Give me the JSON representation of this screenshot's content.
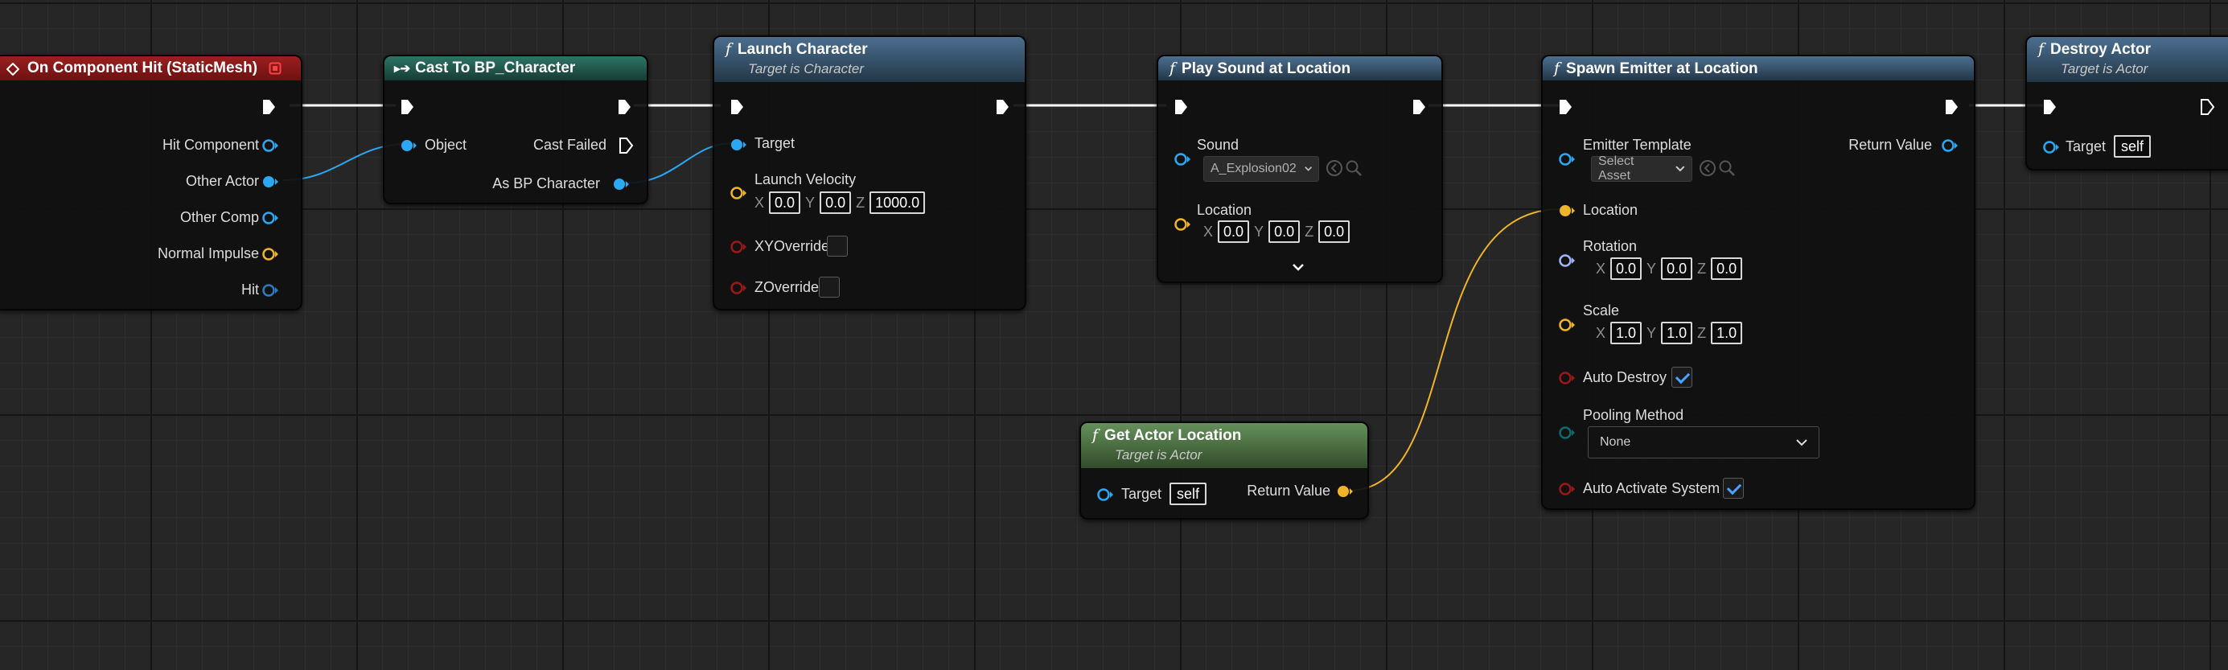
{
  "nodes": {
    "on_hit": {
      "title": "On Component Hit (StaticMesh)",
      "pins": [
        "Hit Component",
        "Other Actor",
        "Other Comp",
        "Normal Impulse",
        "Hit"
      ]
    },
    "cast": {
      "title": "Cast To BP_Character",
      "object": "Object",
      "cast_failed": "Cast Failed",
      "as_bp": "As BP Character"
    },
    "launch": {
      "title": "Launch Character",
      "subtitle": "Target is Character",
      "target": "Target",
      "launch_velocity": "Launch Velocity",
      "vx": "0.0",
      "vy": "0.0",
      "vz": "1000.0",
      "xy_override": "XYOverride",
      "z_override": "ZOverride"
    },
    "play_sound": {
      "title": "Play Sound at Location",
      "sound": "Sound",
      "sound_asset": "A_Explosion02",
      "location": "Location",
      "lx": "0.0",
      "ly": "0.0",
      "lz": "0.0"
    },
    "spawn": {
      "title": "Spawn Emitter at Location",
      "emitter_template": "Emitter Template",
      "select_asset": "Select Asset",
      "return_value": "Return Value",
      "location": "Location",
      "rotation": "Rotation",
      "rx": "0.0",
      "ry": "0.0",
      "rz": "0.0",
      "scale": "Scale",
      "sx": "1.0",
      "sy": "1.0",
      "sz": "1.0",
      "auto_destroy": "Auto Destroy",
      "pooling_method": "Pooling Method",
      "pooling_value": "None",
      "auto_activate": "Auto Activate System"
    },
    "destroy": {
      "title": "Destroy Actor",
      "subtitle": "Target is Actor",
      "target": "Target",
      "target_value": "self"
    },
    "get_loc": {
      "title": "Get Actor Location",
      "subtitle": "Target is Actor",
      "target": "Target",
      "target_value": "self",
      "return_value": "Return Value"
    }
  },
  "axis_letters": {
    "x": "X",
    "y": "Y",
    "z": "Z"
  },
  "colors": {
    "object_pin": "#2aa8f5",
    "struct_pin": "#f0b428",
    "bool_pin": "#8c1010",
    "rotator_pin": "#a0b4ff",
    "enum_pin": "#005c5c",
    "wire_exec": "#ffffff",
    "wire_object": "#2aa8f5",
    "wire_struct": "#f0b428"
  }
}
